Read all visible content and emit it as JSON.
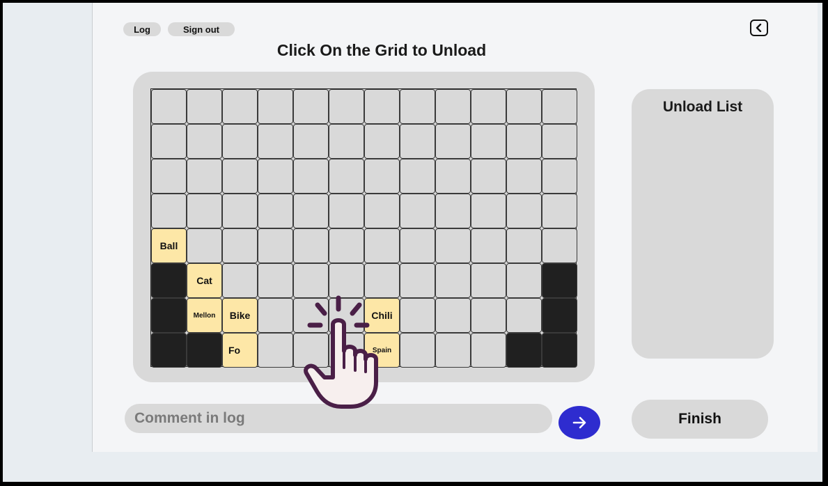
{
  "header": {
    "log_label": "Log",
    "signout_label": "Sign out",
    "title": "Click On the Grid to Unload",
    "back_icon": "chevron-left-icon"
  },
  "grid": {
    "rows": 8,
    "cols": 12,
    "cells": [
      {
        "row": 4,
        "col": 0,
        "label": "Ball",
        "state": "item"
      },
      {
        "row": 5,
        "col": 0,
        "label": "",
        "state": "blocked"
      },
      {
        "row": 5,
        "col": 1,
        "label": "Cat",
        "state": "item"
      },
      {
        "row": 5,
        "col": 11,
        "label": "",
        "state": "blocked"
      },
      {
        "row": 6,
        "col": 0,
        "label": "",
        "state": "blocked"
      },
      {
        "row": 6,
        "col": 1,
        "label": "Mellon",
        "state": "item",
        "small": true
      },
      {
        "row": 6,
        "col": 2,
        "label": "Bike",
        "state": "item"
      },
      {
        "row": 6,
        "col": 6,
        "label": "Chili",
        "state": "item"
      },
      {
        "row": 6,
        "col": 11,
        "label": "",
        "state": "blocked"
      },
      {
        "row": 7,
        "col": 0,
        "label": "",
        "state": "blocked"
      },
      {
        "row": 7,
        "col": 1,
        "label": "",
        "state": "blocked"
      },
      {
        "row": 7,
        "col": 2,
        "label": "Fo",
        "state": "item",
        "left": true
      },
      {
        "row": 7,
        "col": 6,
        "label": "Spain",
        "state": "item",
        "small": true
      },
      {
        "row": 7,
        "col": 10,
        "label": "",
        "state": "blocked"
      },
      {
        "row": 7,
        "col": 11,
        "label": "",
        "state": "blocked"
      }
    ]
  },
  "unload_list": {
    "title": "Unload List",
    "items": []
  },
  "comment": {
    "placeholder": "Comment in log"
  },
  "send_icon": "arrow-right-icon",
  "finish_label": "Finish",
  "overlay_icon": "tap-hand-icon",
  "colors": {
    "item": "#fde7a7",
    "blocked": "#202020",
    "empty": "#d9d9d9",
    "send": "#2e2ccf",
    "hand": "#4a1f47"
  }
}
